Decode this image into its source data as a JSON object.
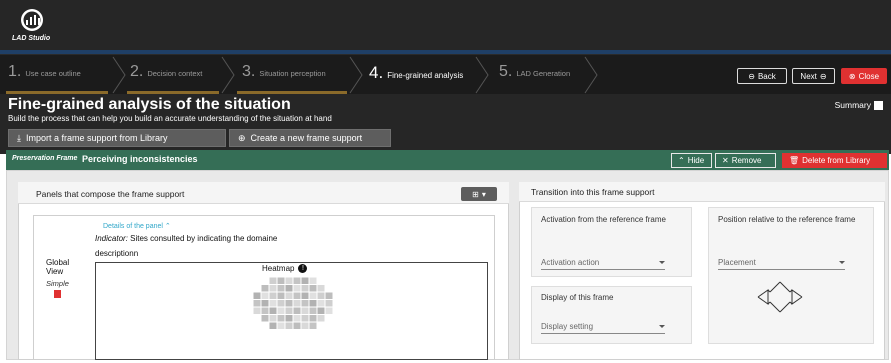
{
  "app": {
    "logo_text": "LAD Studio"
  },
  "steps": [
    {
      "num": "1.",
      "label": "Use case outline"
    },
    {
      "num": "2.",
      "label": "Decision context"
    },
    {
      "num": "3.",
      "label": "Situation perception"
    },
    {
      "num": "4.",
      "label": "Fine-grained analysis"
    },
    {
      "num": "5.",
      "label": "LAD Generation"
    }
  ],
  "nav": {
    "back": "Back",
    "next": "Next",
    "close": "Close"
  },
  "page": {
    "title": "Fine-grained analysis of the situation",
    "subtitle": "Build the process that can help you build an accurate understanding of the situation at hand",
    "summary": "Summary"
  },
  "toolbar": {
    "import": "Import a frame support from Library",
    "create": "Create a new frame support"
  },
  "frame": {
    "tag": "Preservation Frame",
    "name": "Perceiving inconsistencies",
    "hide": "Hide",
    "remove": "Remove",
    "delete": "Delete from Library"
  },
  "panels": {
    "header": "Panels that compose the frame support",
    "details": "Details of the panel",
    "indicator_label": "Indicator:",
    "indicator_value": "Sites consulted by indicating the domaine",
    "description": "descriptionn",
    "view_name": "Global View",
    "view_type": "Simple",
    "heatmap_title": "Heatmap"
  },
  "transition": {
    "header": "Transition into this frame support",
    "activation_title": "Activation from the reference frame",
    "activation_select": "Activation action",
    "display_title": "Display of this frame",
    "display_select": "Display setting",
    "position_title": "Position relative to the reference frame",
    "position_select": "Placement"
  },
  "colors": {
    "accent_red": "#e03131",
    "frame_green": "#356e56",
    "link_blue": "#31a7c9",
    "topbar": "#262626"
  }
}
